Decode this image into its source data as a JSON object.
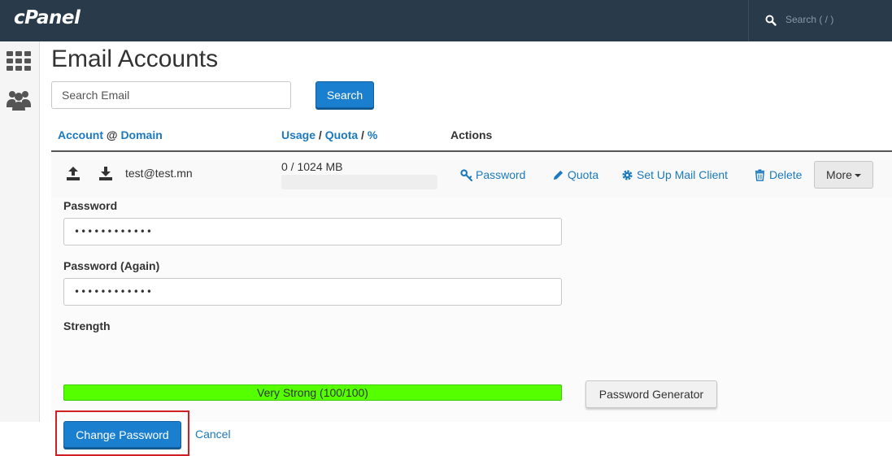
{
  "app": {
    "logo_text": "cPanel",
    "top_search_placeholder": "Search ( / )",
    "brand_color": "#293a4a",
    "accent_color": "#1b7fd0"
  },
  "sidebar": {
    "icons": [
      "grid-icon",
      "users-icon"
    ]
  },
  "page": {
    "title": "Email Accounts"
  },
  "search": {
    "placeholder": "Search Email",
    "button_label": "Search"
  },
  "table": {
    "headers": {
      "account": "Account",
      "at": "@",
      "domain": "Domain",
      "usage": "Usage",
      "slash1": "/",
      "quota": "Quota",
      "slash2": "/",
      "percent": "%",
      "actions": "Actions"
    },
    "rows": [
      {
        "email": "test@test.mn",
        "usage_text": "0 / 1024 MB",
        "usage_fraction": 0,
        "actions": {
          "password": "Password",
          "quota": "Quota",
          "mail_client": "Set Up Mail Client",
          "delete": "Delete",
          "more": "More"
        }
      }
    ]
  },
  "password_form": {
    "password_label": "Password",
    "password_value": "••••••••••••",
    "password_again_label": "Password (Again)",
    "password_again_value": "••••••••••••",
    "strength_label": "Strength",
    "strength_text": "Very Strong (100/100)",
    "strength_value": 100,
    "strength_color": "#55ff00",
    "generator_label": "Password Generator",
    "change_label": "Change Password",
    "cancel_label": "Cancel"
  }
}
